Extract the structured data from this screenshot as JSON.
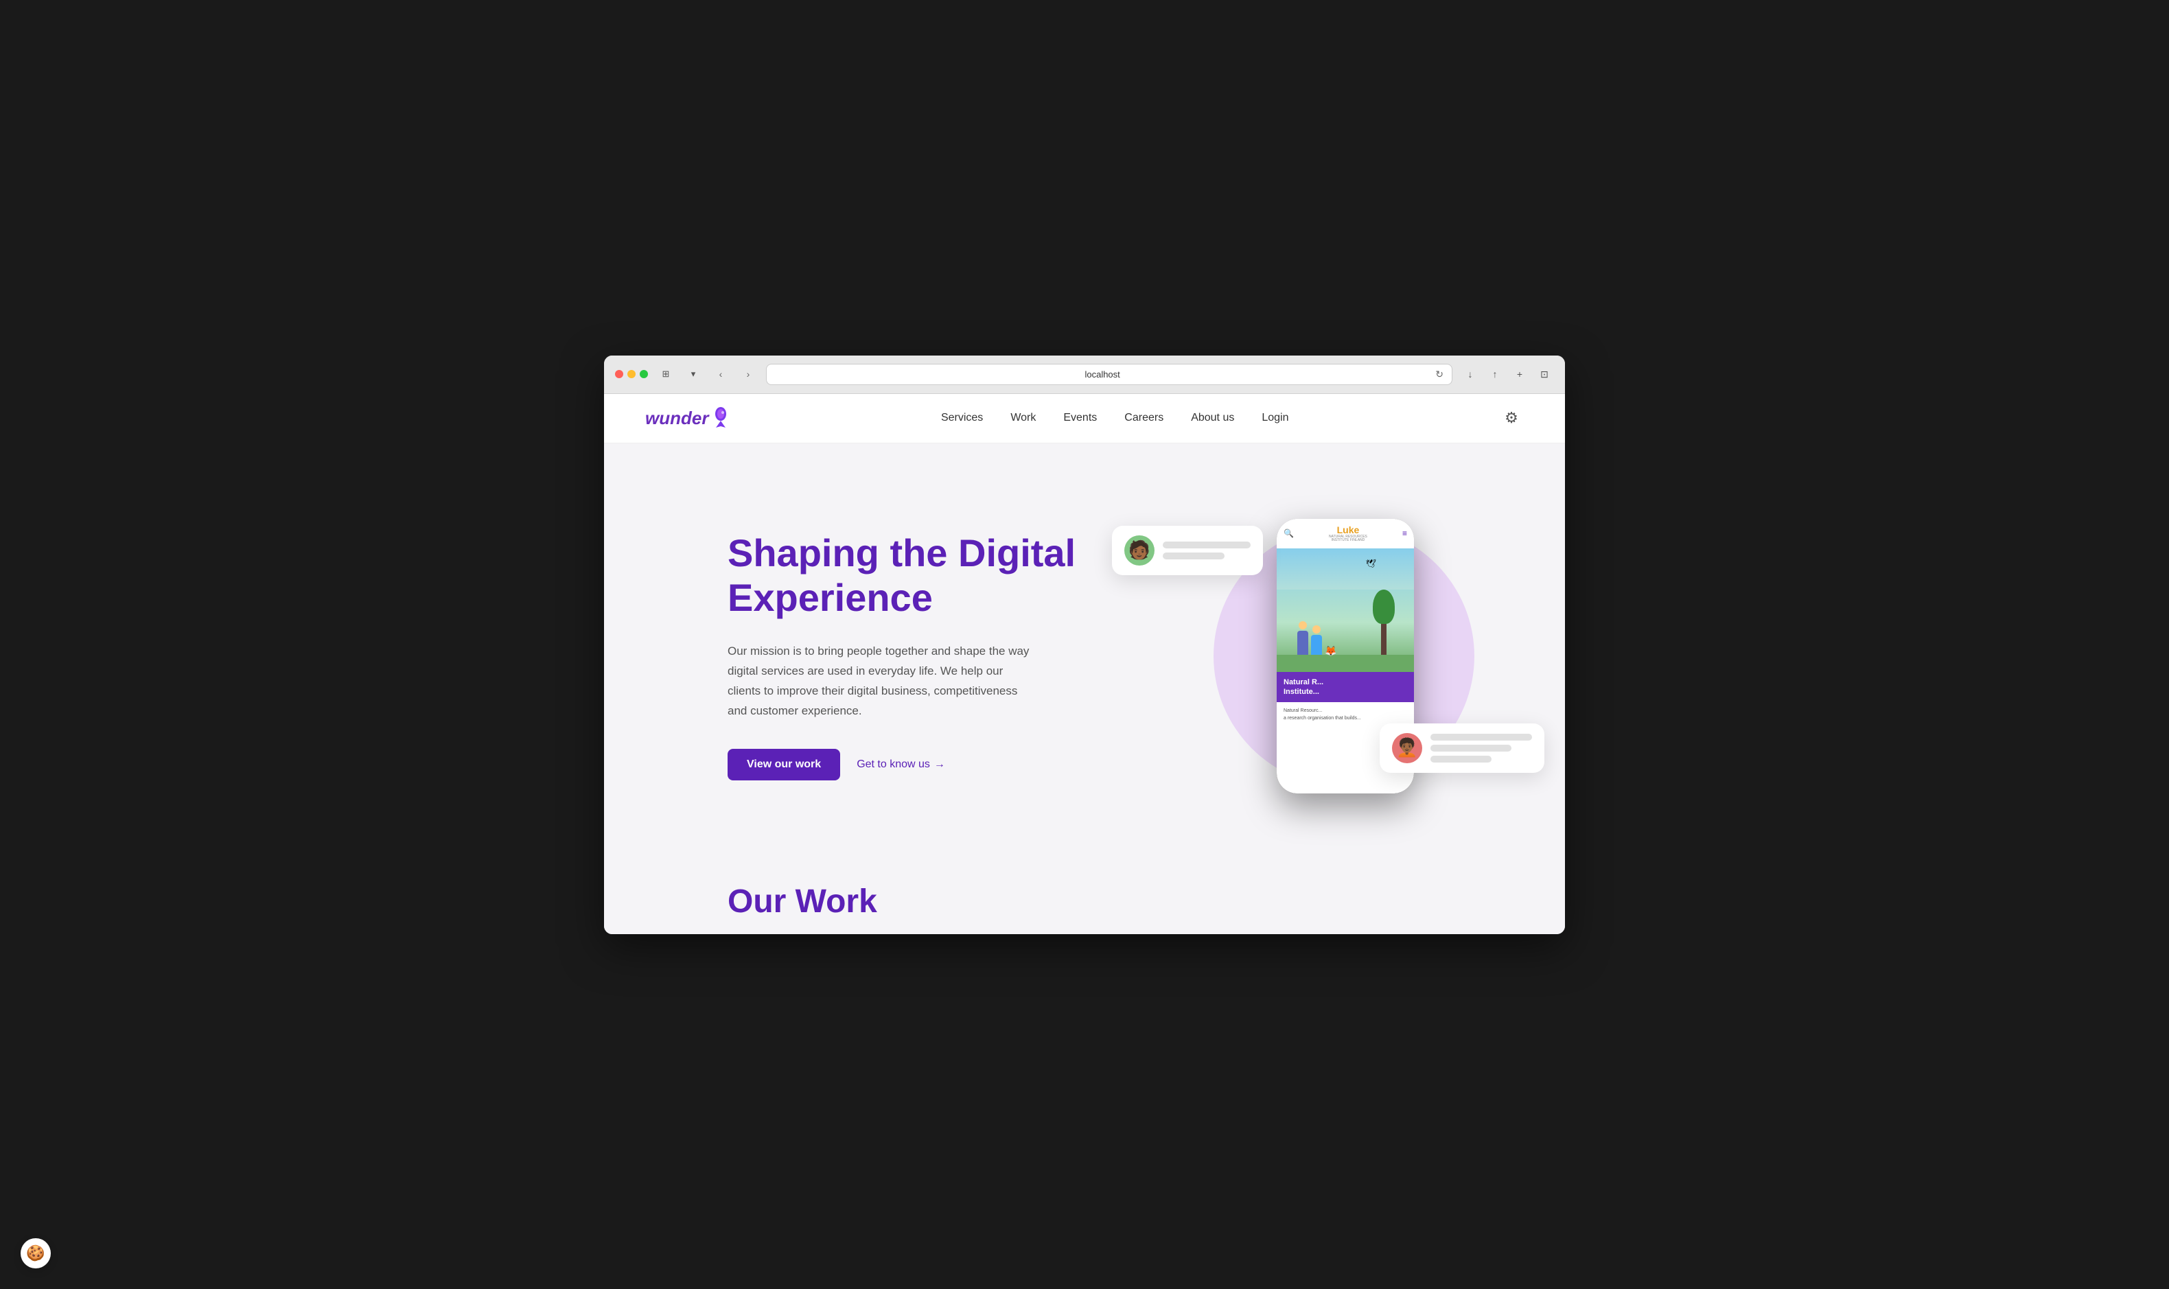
{
  "browser": {
    "url": "localhost",
    "tab_icon": "⊞",
    "tab_dropdown": "▾",
    "back": "‹",
    "forward": "›",
    "refresh": "↻",
    "download": "↓",
    "share": "↑",
    "add_tab": "+",
    "tabs": "⊡"
  },
  "logo": {
    "text": "wunder",
    "icon_label": "wunder-logo-icon"
  },
  "nav": {
    "links": [
      {
        "label": "Services",
        "href": "#"
      },
      {
        "label": "Work",
        "href": "#"
      },
      {
        "label": "Events",
        "href": "#"
      },
      {
        "label": "Careers",
        "href": "#"
      },
      {
        "label": "About us",
        "href": "#"
      },
      {
        "label": "Login",
        "href": "#"
      }
    ]
  },
  "hero": {
    "title": "Shaping the Digital Experience",
    "description": "Our mission is to bring people together and shape the way digital services are used in everyday life. We help our clients to improve their digital business, competitiveness and customer experience.",
    "cta_primary": "View our work",
    "cta_secondary": "Get to know us",
    "cta_arrow": "→"
  },
  "phone": {
    "search_icon": "🔍",
    "logo": "Luke",
    "logo_sub": "NATURAL RESOURCES\nINSTITUTE FINLAND",
    "menu_icon": "≡",
    "content_title": "Natural R...\nInstitute...",
    "content_sub": "Natural Resourc...\na research organisation that builds..."
  },
  "float_card_top": {
    "lines": [
      "full",
      "short"
    ]
  },
  "float_card_bottom": {
    "lines": [
      "full",
      "short"
    ]
  },
  "our_work": {
    "title": "Our Work"
  },
  "cookie": {
    "icon": "🍪",
    "label": "cookie-consent"
  },
  "settings": {
    "icon": "⚙"
  },
  "colors": {
    "brand_purple": "#6b2fbd",
    "purple_light": "#e8d5f5",
    "hero_bg": "#f5f4f7"
  }
}
